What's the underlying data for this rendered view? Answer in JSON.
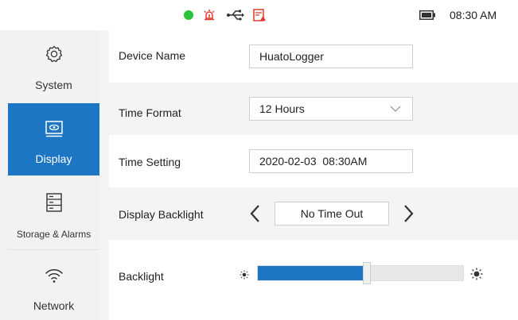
{
  "status_bar": {
    "time": "08:30 AM",
    "icons": [
      "status-dot-icon",
      "alarm-icon",
      "usb-icon",
      "storage-warning-icon",
      "battery-icon"
    ],
    "colors": {
      "status_ok": "#29c43a",
      "alarm": "#e03a2f"
    }
  },
  "sidebar": {
    "items": [
      {
        "label": "System",
        "icon": "gear-icon"
      },
      {
        "label": "Display",
        "icon": "display-icon",
        "active": true
      },
      {
        "label": "Storage & Alarms",
        "icon": "storage-icon"
      },
      {
        "label": "Network",
        "icon": "wifi-icon"
      }
    ]
  },
  "settings": {
    "device_name": {
      "label": "Device Name",
      "value": "HuatoLogger"
    },
    "time_format": {
      "label": "Time Format",
      "value": "12 Hours"
    },
    "time_setting": {
      "label": "Time Setting",
      "value": "2020-02-03  08:30AM"
    },
    "display_backlight": {
      "label": "Display Backlight",
      "value": "No Time Out"
    },
    "backlight": {
      "label": "Backlight",
      "level_percent": 53
    }
  },
  "colors": {
    "accent": "#1d76c4"
  }
}
